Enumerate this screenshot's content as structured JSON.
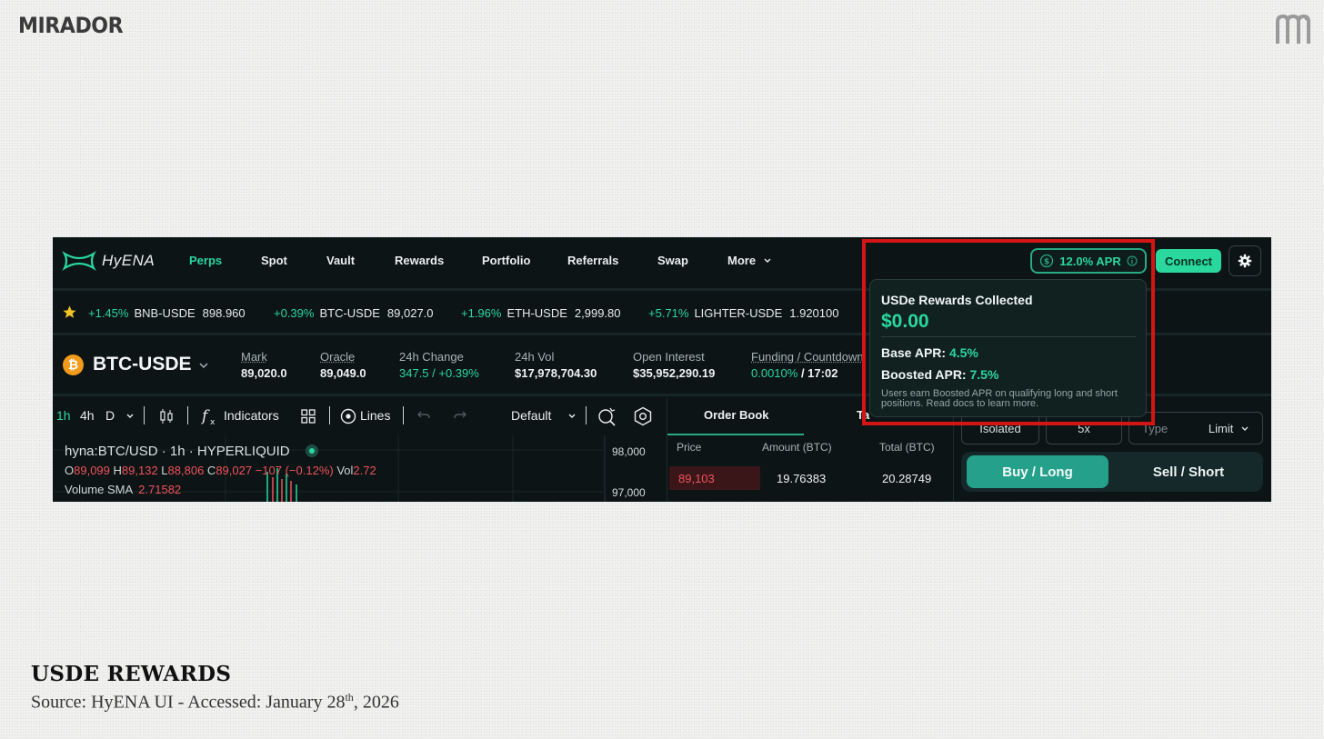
{
  "slide": {
    "brand": "MIRADOR",
    "caption_title": "USDE REWARDS",
    "caption_source_prefix": "Source: HyENA UI - Accessed: January 28",
    "caption_source_sup": "th",
    "caption_source_suffix": ", 2026"
  },
  "app": {
    "logo_text": "HyENA",
    "nav": [
      {
        "label": "Perps",
        "active": true
      },
      {
        "label": "Spot"
      },
      {
        "label": "Vault"
      },
      {
        "label": "Rewards"
      },
      {
        "label": "Portfolio"
      },
      {
        "label": "Referrals"
      },
      {
        "label": "Swap"
      },
      {
        "label": "More"
      }
    ],
    "apr_pill": "12.0% APR",
    "connect_label": "Connect",
    "ticker": [
      {
        "change": "+1.45%",
        "symbol": "BNB-USDE",
        "price": "898.960"
      },
      {
        "change": "+0.39%",
        "symbol": "BTC-USDE",
        "price": "89,027.0"
      },
      {
        "change": "+1.96%",
        "symbol": "ETH-USDE",
        "price": "2,999.80"
      },
      {
        "change": "+5.71%",
        "symbol": "LIGHTER-USDE",
        "price": "1.920100"
      }
    ],
    "market": {
      "coin_glyph": "₿",
      "pair": "BTC-USDE",
      "mark_label": "Mark",
      "mark_value": "89,020.0",
      "oracle_label": "Oracle",
      "oracle_value": "89,049.0",
      "change_label": "24h Change",
      "change_value": "347.5 / +0.39%",
      "vol_label": "24h Vol",
      "vol_value": "$17,978,704.30",
      "oi_label": "Open Interest",
      "oi_value": "$35,952,290.19",
      "funding_label": "Funding / Countdown",
      "funding_rate": "0.0010%",
      "funding_countdown": "/ 17:02"
    },
    "toolbar": {
      "tf_1h": "1h",
      "tf_4h": "4h",
      "tf_d": "D",
      "indicators": "Indicators",
      "lines": "Lines",
      "default": "Default"
    },
    "chart": {
      "title": "hyna:BTC/USD · 1h · HYPERLIQUID",
      "o_label": "O",
      "o_value": "89,099",
      "h_label": "H",
      "h_value": "89,132",
      "l_label": "L",
      "l_value": "88,806",
      "c_label": "C",
      "c_value": "89,027",
      "chg_value": "−107 (−0.12%)",
      "vol_label": "Vol",
      "vol_value": "2.72",
      "sma_label": "Volume SMA",
      "sma_value": "2.71582",
      "axis_top": "98,000",
      "axis_bottom": "97,000"
    },
    "orderbook": {
      "tab_1": "Order Book",
      "tab_2": "Ta",
      "col_price": "Price",
      "col_amount": "Amount (BTC)",
      "col_total": "Total (BTC)",
      "row_price": "89,103",
      "row_amount": "19.76383",
      "row_total": "20.28749"
    },
    "order_panel": {
      "margin_mode": "Isolated",
      "leverage": "5x",
      "type_placeholder": "Type",
      "type_value": "Limit",
      "buy_label": "Buy / Long",
      "sell_label": "Sell / Short"
    },
    "popover": {
      "title": "USDe Rewards Collected",
      "amount": "$0.00",
      "base_label": "Base APR:",
      "base_value": "4.5%",
      "boosted_label": "Boosted APR:",
      "boosted_value": "7.5%",
      "note": "Users earn Boosted APR on qualifying long and short positions. Read docs to learn more."
    }
  }
}
